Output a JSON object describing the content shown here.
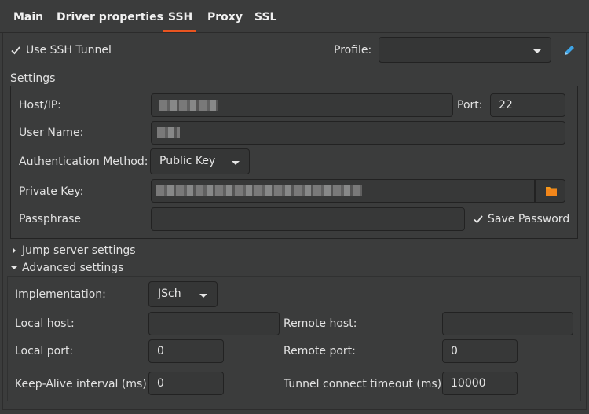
{
  "tabs": [
    {
      "label": "Main"
    },
    {
      "label": "Driver properties"
    },
    {
      "label": "SSH",
      "active": true
    },
    {
      "label": "Proxy"
    },
    {
      "label": "SSL"
    }
  ],
  "use_ssh_tunnel": {
    "label": "Use SSH Tunnel",
    "checked": true
  },
  "profile": {
    "label": "Profile:",
    "value": ""
  },
  "settings": {
    "title": "Settings",
    "host_label": "Host/IP:",
    "host_value": "",
    "port_label": "Port:",
    "port_value": "22",
    "user_label": "User Name:",
    "user_value": "",
    "auth_label": "Authentication Method:",
    "auth_value": "Public Key",
    "private_key_label": "Private Key:",
    "private_key_value": "",
    "passphrase_label": "Passphrase",
    "passphrase_value": "",
    "save_password_label": "Save Password",
    "save_password_checked": true
  },
  "jump_server": {
    "label": "Jump server settings",
    "expanded": false
  },
  "advanced": {
    "label": "Advanced settings",
    "expanded": true,
    "implementation_label": "Implementation:",
    "implementation_value": "JSch",
    "local_host_label": "Local host:",
    "local_host_value": "",
    "remote_host_label": "Remote host:",
    "remote_host_value": "",
    "local_port_label": "Local port:",
    "local_port_value": "0",
    "remote_port_label": "Remote port:",
    "remote_port_value": "0",
    "keepalive_label": "Keep-Alive interval (ms):",
    "keepalive_value": "0",
    "timeout_label": "Tunnel connect timeout (ms):",
    "timeout_value": "10000"
  },
  "colors": {
    "background": "#3b3c3c",
    "accent": "#e95420",
    "edit_icon": "#3ea4e6",
    "folder_icon": "#f59a1a"
  },
  "icons": {
    "edit": "pencil-icon",
    "browse": "folder-icon",
    "check": "checkmark-icon"
  }
}
